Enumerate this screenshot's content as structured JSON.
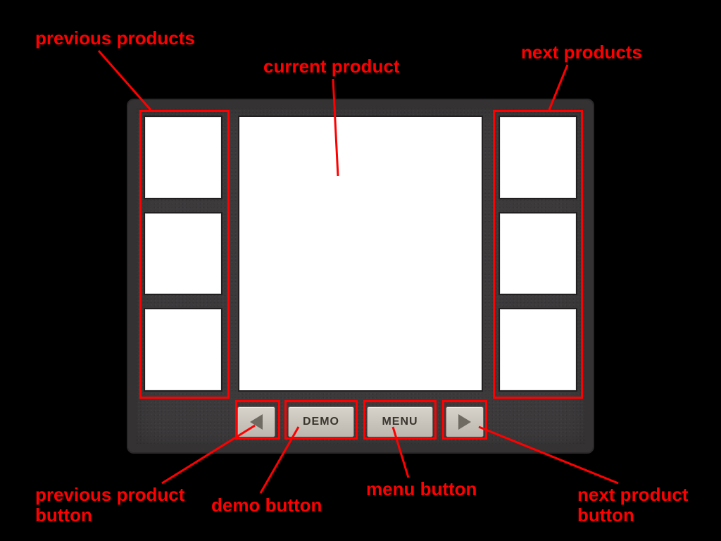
{
  "buttons": {
    "demo": "DEMO",
    "menu": "MENU"
  },
  "annotations": {
    "previous_products": "previous products",
    "next_products": "next products",
    "current_product": "current product",
    "previous_button": "previous product\nbutton",
    "demo_button": "demo button",
    "menu_button": "menu button",
    "next_button": "next product\nbutton"
  }
}
